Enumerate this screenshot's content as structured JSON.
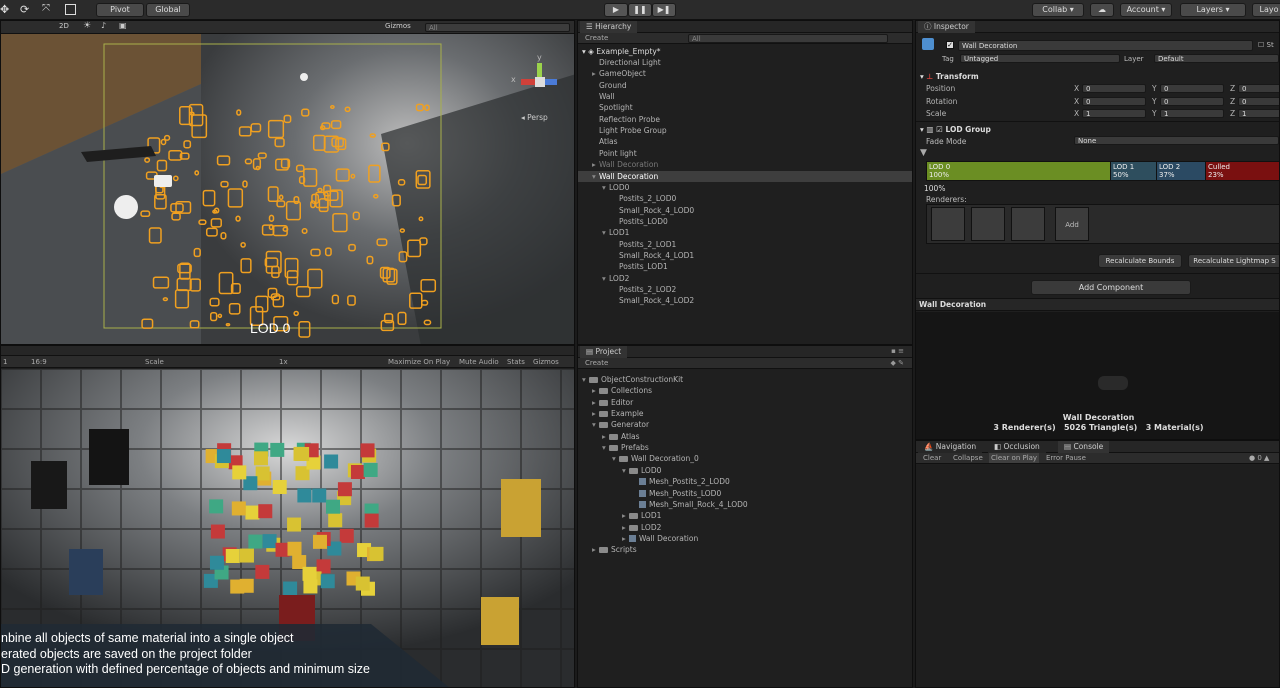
{
  "toolbar": {
    "pivot": "Pivot",
    "global": "Global",
    "collab": "Collab",
    "account": "Account",
    "layers": "Layers",
    "layout": "Layo"
  },
  "scene": {
    "mode_2d": "2D",
    "gizmos": "Gizmos",
    "search_placeholder": "All",
    "persp": "Persp",
    "lod_label": "LOD 0",
    "axis_y": "y",
    "axis_x": "x"
  },
  "game": {
    "aspect": "16:9",
    "scale_label": "Scale",
    "scale_value": "1x",
    "maximize": "Maximize On Play",
    "mute": "Mute Audio",
    "stats": "Stats",
    "gizmos": "Gizmos",
    "caption_lines": [
      "nbine all objects of same material into a single object",
      "erated objects are saved on the project folder",
      "D generation with defined percentage of objects and minimum size"
    ]
  },
  "hierarchy": {
    "tab": "Hierarchy",
    "create": "Create",
    "search_placeholder": "All",
    "scene_name": "Example_Empty*",
    "items": [
      {
        "label": "Directional Light",
        "indent": 0,
        "arrow": ""
      },
      {
        "label": "GameObject",
        "indent": 0,
        "arrow": "▸"
      },
      {
        "label": "Ground",
        "indent": 0,
        "arrow": ""
      },
      {
        "label": "Wall",
        "indent": 0,
        "arrow": ""
      },
      {
        "label": "Spotlight",
        "indent": 0,
        "arrow": ""
      },
      {
        "label": "Reflection Probe",
        "indent": 0,
        "arrow": ""
      },
      {
        "label": "Light Probe Group",
        "indent": 0,
        "arrow": ""
      },
      {
        "label": "Atlas",
        "indent": 0,
        "arrow": ""
      },
      {
        "label": "Point light",
        "indent": 0,
        "arrow": ""
      },
      {
        "label": "Wall Decoration",
        "indent": 0,
        "arrow": "▸",
        "dim": true
      },
      {
        "label": "Wall Decoration",
        "indent": 0,
        "arrow": "▾",
        "selected": true
      },
      {
        "label": "LOD0",
        "indent": 1,
        "arrow": "▾"
      },
      {
        "label": "Postits_2_LOD0",
        "indent": 2,
        "arrow": ""
      },
      {
        "label": "Small_Rock_4_LOD0",
        "indent": 2,
        "arrow": ""
      },
      {
        "label": "Postits_LOD0",
        "indent": 2,
        "arrow": ""
      },
      {
        "label": "LOD1",
        "indent": 1,
        "arrow": "▾"
      },
      {
        "label": "Postits_2_LOD1",
        "indent": 2,
        "arrow": ""
      },
      {
        "label": "Small_Rock_4_LOD1",
        "indent": 2,
        "arrow": ""
      },
      {
        "label": "Postits_LOD1",
        "indent": 2,
        "arrow": ""
      },
      {
        "label": "LOD2",
        "indent": 1,
        "arrow": "▾"
      },
      {
        "label": "Postits_2_LOD2",
        "indent": 2,
        "arrow": ""
      },
      {
        "label": "Small_Rock_4_LOD2",
        "indent": 2,
        "arrow": ""
      }
    ]
  },
  "project": {
    "tab": "Project",
    "create": "Create",
    "items": [
      {
        "label": "ObjectConstructionKit",
        "indent": 0,
        "arrow": "▾",
        "icon": "folder"
      },
      {
        "label": "Collections",
        "indent": 1,
        "arrow": "▸",
        "icon": "folder"
      },
      {
        "label": "Editor",
        "indent": 1,
        "arrow": "▸",
        "icon": "folder"
      },
      {
        "label": "Example",
        "indent": 1,
        "arrow": "▸",
        "icon": "folder"
      },
      {
        "label": "Generator",
        "indent": 1,
        "arrow": "▾",
        "icon": "folder"
      },
      {
        "label": "Atlas",
        "indent": 2,
        "arrow": "▸",
        "icon": "folder"
      },
      {
        "label": "Prefabs",
        "indent": 2,
        "arrow": "▾",
        "icon": "folder"
      },
      {
        "label": "Wall Decoration_0",
        "indent": 3,
        "arrow": "▾",
        "icon": "folder"
      },
      {
        "label": "LOD0",
        "indent": 4,
        "arrow": "▾",
        "icon": "folder"
      },
      {
        "label": "Mesh_Postits_2_LOD0",
        "indent": 5,
        "arrow": "",
        "icon": "mesh"
      },
      {
        "label": "Mesh_Postits_LOD0",
        "indent": 5,
        "arrow": "",
        "icon": "mesh"
      },
      {
        "label": "Mesh_Small_Rock_4_LOD0",
        "indent": 5,
        "arrow": "",
        "icon": "mesh"
      },
      {
        "label": "LOD1",
        "indent": 4,
        "arrow": "▸",
        "icon": "folder"
      },
      {
        "label": "LOD2",
        "indent": 4,
        "arrow": "▸",
        "icon": "folder"
      },
      {
        "label": "Wall Decoration",
        "indent": 4,
        "arrow": "▸",
        "icon": "mesh"
      },
      {
        "label": "Scripts",
        "indent": 1,
        "arrow": "▸",
        "icon": "folder"
      }
    ]
  },
  "inspector": {
    "tab": "Inspector",
    "object_name": "Wall Decoration",
    "static": "St",
    "tag_label": "Tag",
    "tag_value": "Untagged",
    "layer_label": "Layer",
    "layer_value": "Default",
    "transform": {
      "title": "Transform",
      "rows": [
        {
          "label": "Position",
          "x": "0",
          "y": "0",
          "z": "0"
        },
        {
          "label": "Rotation",
          "x": "0",
          "y": "0",
          "z": "0"
        },
        {
          "label": "Scale",
          "x": "1",
          "y": "1",
          "z": "1"
        }
      ]
    },
    "lod_group": {
      "title": "LOD Group",
      "fade_mode_label": "Fade Mode",
      "fade_mode_value": "None",
      "levels": [
        {
          "name": "LOD 0",
          "pct": "100%",
          "color": "#6b8e23",
          "fraction": 0.52
        },
        {
          "name": "LOD 1",
          "pct": "50%",
          "color": "#2e4e5e",
          "fraction": 0.13
        },
        {
          "name": "LOD 2",
          "pct": "37%",
          "color": "#2b4a63",
          "fraction": 0.14
        },
        {
          "name": "Culled",
          "pct": "23%",
          "color": "#7a1010",
          "fraction": 0.21
        }
      ],
      "current_pct": "100%",
      "renderers_label": "Renderers:",
      "add_label": "Add",
      "recalc_bounds": "Recalculate Bounds",
      "recalc_lightmap": "Recalculate Lightmap S"
    },
    "add_component": "Add Component",
    "preview": {
      "title": "Wall Decoration",
      "name": "Wall Decoration",
      "stats": "3 Renderer(s)   5026 Triangle(s)   3 Material(s)"
    }
  },
  "console": {
    "tabs": [
      "Navigation",
      "Occlusion",
      "Console"
    ],
    "clear": "Clear",
    "collapse": "Collapse",
    "clear_on_play": "Clear on Play",
    "error_pause": "Error Pause",
    "count": "0"
  }
}
